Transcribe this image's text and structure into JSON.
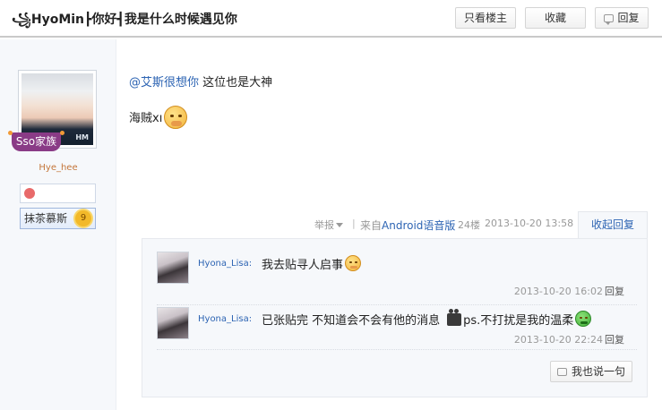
{
  "thread": {
    "title": "꧁HyoMin┣你好┫我是什么时候遇见你",
    "buttons": {
      "only_owner": "只看楼主",
      "favorite": "收藏",
      "reply": "回复"
    }
  },
  "author": {
    "avatar_watermark": "HM",
    "family_badge": "Sso家族",
    "username": "Hye_hee",
    "level_badge_name": "抹茶慕斯",
    "level": "9"
  },
  "post": {
    "mention": "@艾斯很想你",
    "line1_text": "这位也是大神",
    "line2_text": "海贼xı",
    "emoji_icon": "shush-emoji",
    "report_label": "举报",
    "separator": "|",
    "source_prefix": "来自",
    "source_device": "Android语音版",
    "floor": "24楼",
    "time": "2013-10-20 13:58",
    "collapse_label": "收起回复"
  },
  "replies": [
    {
      "user": "Hyona_Lisa:",
      "text": "我去贴寻人启事",
      "emoji_icon": "angry-emoji",
      "time": "2013-10-20 16:02",
      "reply_label": "回复"
    },
    {
      "user": "Hyona_Lisa:",
      "text_a": "已张贴完 不知道会不会有他的消息",
      "text_b": "ps.不打扰是我的温柔",
      "emoji_icons": [
        "camera-emoji",
        "green-emoji"
      ],
      "time": "2013-10-20 22:24",
      "reply_label": "回复"
    }
  ],
  "say_button": "我也说一句"
}
